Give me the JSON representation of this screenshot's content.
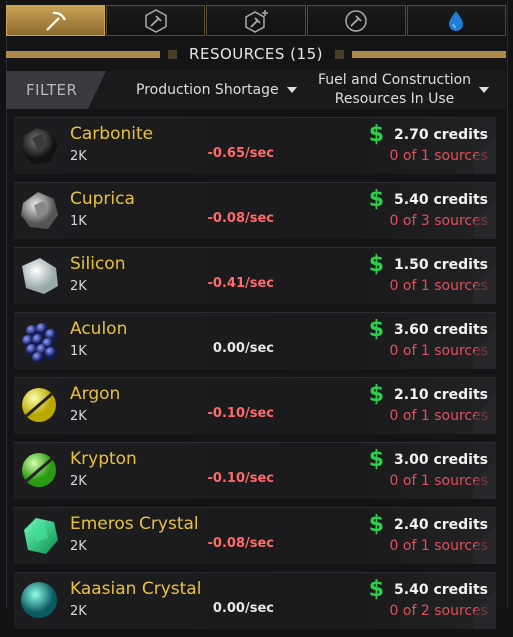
{
  "tabs": [
    {
      "icon": "pickaxe-icon",
      "active": true
    },
    {
      "icon": "hex-hammer-icon",
      "active": false
    },
    {
      "icon": "hex-hammer-plus-icon",
      "active": false
    },
    {
      "icon": "circle-hammer-icon",
      "active": false
    },
    {
      "icon": "water-drop-icon",
      "active": false
    }
  ],
  "header": {
    "title": "RESOURCES (15)"
  },
  "filter": {
    "label": "FILTER",
    "dropdown1": "Production Shortage",
    "dropdown2_line1": "Fuel and Construction",
    "dropdown2_line2": "Resources In Use"
  },
  "resources": [
    {
      "name": "Carbonite",
      "qty": "2K",
      "rate": "-0.65/sec",
      "credits": "2.70 credits",
      "sources": "0 of 1 sources",
      "icon": "carbonite-icon"
    },
    {
      "name": "Cuprica",
      "qty": "1K",
      "rate": "-0.08/sec",
      "credits": "5.40 credits",
      "sources": "0 of 3 sources",
      "icon": "cuprica-icon"
    },
    {
      "name": "Silicon",
      "qty": "2K",
      "rate": "-0.41/sec",
      "credits": "1.50 credits",
      "sources": "0 of 1 sources",
      "icon": "silicon-icon"
    },
    {
      "name": "Aculon",
      "qty": "1K",
      "rate": "0.00/sec",
      "credits": "3.60 credits",
      "sources": "0 of 1 sources",
      "icon": "aculon-icon"
    },
    {
      "name": "Argon",
      "qty": "2K",
      "rate": "-0.10/sec",
      "credits": "2.10 credits",
      "sources": "0 of 1 sources",
      "icon": "argon-icon"
    },
    {
      "name": "Krypton",
      "qty": "2K",
      "rate": "-0.10/sec",
      "credits": "3.00 credits",
      "sources": "0 of 1 sources",
      "icon": "krypton-icon"
    },
    {
      "name": "Emeros Crystal",
      "qty": "2K",
      "rate": "-0.08/sec",
      "credits": "2.40 credits",
      "sources": "0 of 1 sources",
      "icon": "emeros-crystal-icon"
    },
    {
      "name": "Kaasian Crystal",
      "qty": "2K",
      "rate": "0.00/sec",
      "credits": "5.40 credits",
      "sources": "0 of 2 sources",
      "icon": "kaasian-crystal-icon"
    }
  ],
  "colors": {
    "accent": "#c9a356",
    "name": "#e8c23a",
    "negative": "#ff6a6a",
    "credit_icon": "#2ccf4a",
    "sources": "#e2505a"
  }
}
